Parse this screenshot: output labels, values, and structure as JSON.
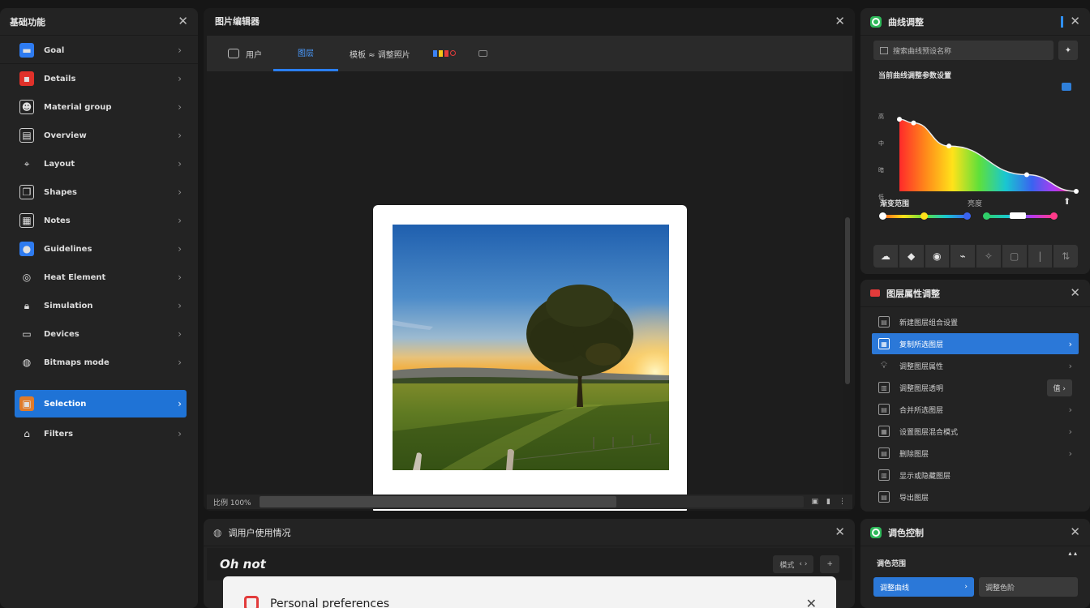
{
  "left_panel": {
    "title": "基础功能",
    "items": [
      {
        "label": "Goal",
        "icon": "folder-blue-icon"
      },
      {
        "label": "Details",
        "icon": "flag-red-icon"
      },
      {
        "label": "Material group",
        "icon": "portrait-icon"
      },
      {
        "label": "Overview",
        "icon": "book-icon"
      },
      {
        "label": "Layout",
        "icon": "pin-icon"
      },
      {
        "label": "Shapes",
        "icon": "copy-icon"
      },
      {
        "label": "Notes",
        "icon": "image-icon"
      },
      {
        "label": "Guidelines",
        "icon": "chat-blue-icon"
      },
      {
        "label": "Heat Element",
        "icon": "target-icon"
      },
      {
        "label": "Simulation",
        "icon": "lock-icon"
      },
      {
        "label": "Devices",
        "icon": "message-icon"
      },
      {
        "label": "Bitmaps mode",
        "icon": "globe-icon"
      },
      {
        "label": "Selection",
        "icon": "image-orange-icon",
        "active": true
      },
      {
        "label": "Filters",
        "icon": "inbox-icon"
      }
    ]
  },
  "viewer": {
    "title": "图片编辑器",
    "tabs": [
      {
        "label": "用户",
        "icon": "image-icon"
      },
      {
        "label": "图层",
        "active": true
      },
      {
        "label": "模板 ≈ 调整照片"
      },
      {
        "label": "",
        "icon": "color-dots-icon"
      },
      {
        "label": "",
        "icon": "camera-icon"
      }
    ],
    "status_left": "比例 100%",
    "status_right_icons": [
      "fit-icon",
      "menu-icon",
      "more-icon"
    ]
  },
  "bottom_panel": {
    "title": "调用户使用情况",
    "big_label": "Oh not",
    "seg_label": "模式",
    "seg_arrows": "‹ ›",
    "dialog_title": "Personal preferences"
  },
  "curves_panel": {
    "title": "曲线调整",
    "search_placeholder": "搜索曲线预设名称",
    "curve_label": "当前曲线调整参数设置",
    "axis_ticks": [
      "高",
      "中",
      "暗",
      "低"
    ],
    "bottom_label": "渐变范围",
    "mid_label": "亮度",
    "chart_data": {
      "type": "line",
      "x": [
        0,
        0.08,
        0.28,
        0.72,
        1.0
      ],
      "y": [
        0.78,
        0.74,
        0.49,
        0.18,
        0.0
      ],
      "xlim": [
        0,
        1
      ],
      "ylim": [
        0,
        1
      ]
    },
    "tools": [
      "auto-icon",
      "tag-icon",
      "circle-icon",
      "link-icon",
      "sparkle-icon",
      "square-icon",
      "bar-icon",
      "sort-icon"
    ]
  },
  "layers_panel": {
    "title": "图层属性调整",
    "items": [
      {
        "label": "新建图层组合设置",
        "icon": "layer-icon"
      },
      {
        "label": "复制所选图层",
        "icon": "copy-icon",
        "active": true
      },
      {
        "label": "调整图层属性",
        "icon": "bulb-icon"
      },
      {
        "label": "调整图层透明",
        "icon": "grid-icon",
        "pill": "值"
      },
      {
        "label": "合并所选图层",
        "icon": "merge-icon"
      },
      {
        "label": "设置图层混合模式",
        "icon": "blend-icon"
      },
      {
        "label": "删除图层",
        "icon": "trash-icon"
      },
      {
        "label": "显示或隐藏图层",
        "icon": "eye-icon"
      },
      {
        "label": "导出图层",
        "icon": "export-icon"
      }
    ]
  },
  "right_bottom": {
    "title": "调色控制",
    "label": "调色范围",
    "btn1": "调整曲线",
    "btn2": "调整色阶"
  }
}
